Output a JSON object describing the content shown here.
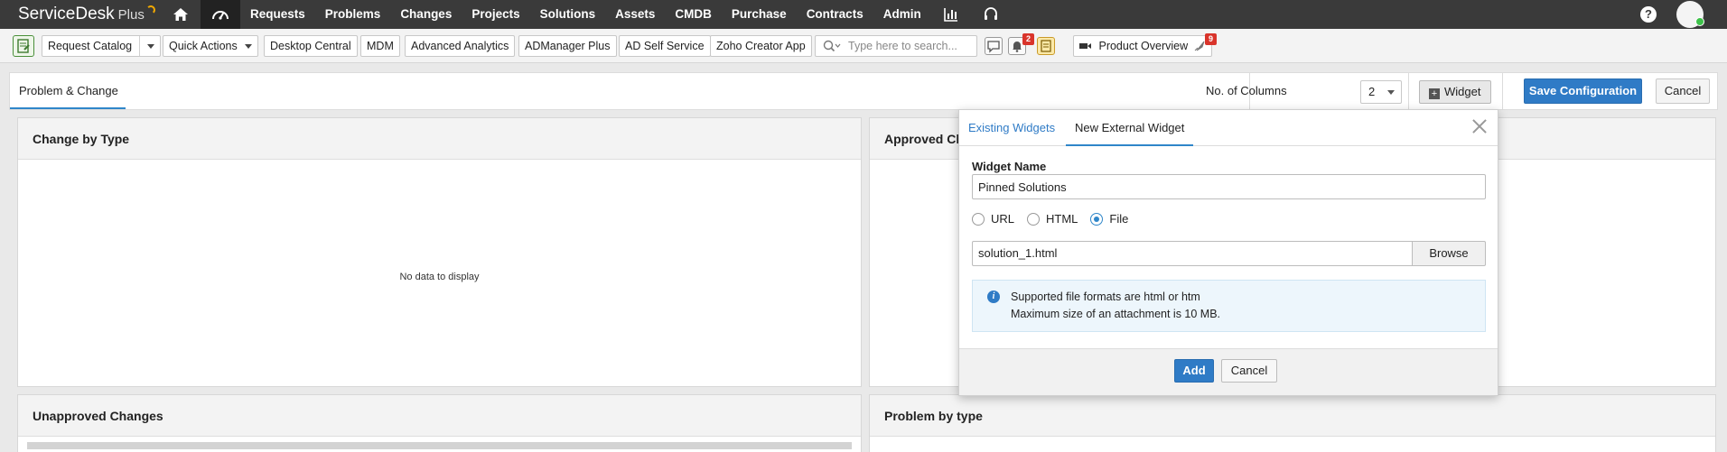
{
  "app": {
    "logo_main": "ServiceDesk",
    "logo_plus": "Plus"
  },
  "topnav": {
    "items": [
      "Requests",
      "Problems",
      "Changes",
      "Projects",
      "Solutions",
      "Assets",
      "CMDB",
      "Purchase",
      "Contracts",
      "Admin"
    ],
    "icons": [
      "home-icon",
      "dashboard-icon",
      "reports-icon",
      "headset-icon",
      "help-icon"
    ],
    "help_label": "?"
  },
  "toolbar": {
    "request_catalog": "Request Catalog",
    "quick_actions": "Quick Actions",
    "desktop_central": "Desktop Central",
    "mdm": "MDM",
    "advanced_analytics": "Advanced Analytics",
    "admanager_plus": "ADManager Plus",
    "ad_self_service": "AD Self Service",
    "zoho_creator": "Zoho Creator App",
    "search_placeholder": "Type here to search...",
    "reminder_badge": "2",
    "product_overview": "Product Overview",
    "product_badge": "9"
  },
  "tabbar": {
    "active_tab": "Problem & Change",
    "columns_label": "No. of Columns",
    "columns_value": "2",
    "widget_label": "Widget",
    "save_label": "Save Configuration",
    "cancel_label": "Cancel"
  },
  "panels": {
    "change_by_type": "Change by Type",
    "no_data": "No data to display",
    "approved_changes": "Approved Ch",
    "unapproved_changes": "Unapproved Changes",
    "problem_by_type": "Problem by type"
  },
  "dialog": {
    "tab_existing": "Existing Widgets",
    "tab_new": "New External Widget",
    "widget_name_label": "Widget Name",
    "widget_name_value": "Pinned Solutions",
    "radio_url": "URL",
    "radio_html": "HTML",
    "radio_file": "File",
    "selected_type": "File",
    "file_value": "solution_1.html",
    "browse_label": "Browse",
    "info_line1": "Supported file formats are html or htm",
    "info_line2": "Maximum size of an attachment is 10 MB.",
    "add_label": "Add",
    "cancel_label": "Cancel"
  },
  "colors": {
    "nav_bg": "#3a3a3a",
    "primary_blue": "#2f7bc6",
    "badge_red": "#d9342b"
  }
}
